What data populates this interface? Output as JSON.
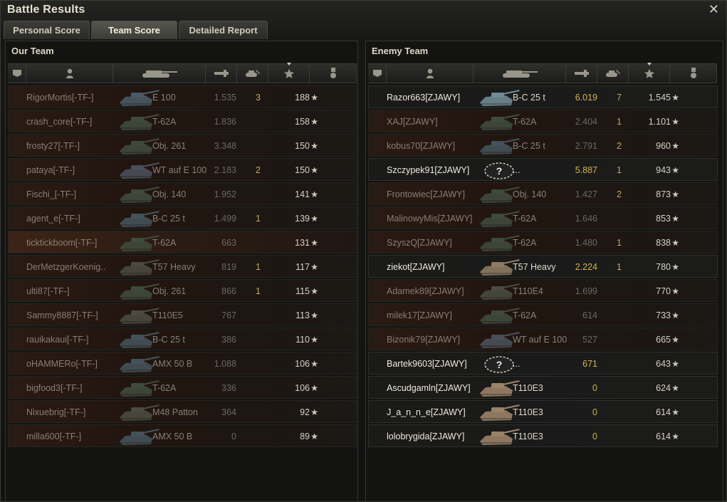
{
  "window": {
    "title": "Battle Results",
    "close": "✕"
  },
  "tabs": [
    "Personal Score",
    "Team Score",
    "Detailed Report"
  ],
  "active_tab": 1,
  "left": {
    "title": "Our Team",
    "rows": [
      {
        "name": "RigorMortis[-TF-]",
        "vehicle": "E 100",
        "damage": "1.535",
        "kills": "3",
        "xp": "188",
        "alive": false,
        "tank": "#4a5a66"
      },
      {
        "name": "crash_core[-TF-]",
        "vehicle": "T-62A",
        "damage": "1.836",
        "kills": "",
        "xp": "158",
        "alive": false,
        "tank": "#3f4a3c"
      },
      {
        "name": "frosty27[-TF-]",
        "vehicle": "Obj. 261",
        "damage": "3.348",
        "kills": "",
        "xp": "150",
        "alive": false,
        "tank": "#3f4a3c"
      },
      {
        "name": "pataya[-TF-]",
        "vehicle": "WT auf E 100",
        "damage": "2.183",
        "kills": "2",
        "xp": "150",
        "alive": false,
        "tank": "#4a4f5a"
      },
      {
        "name": "Fischi_[-TF-]",
        "vehicle": "Obj. 140",
        "damage": "1.952",
        "kills": "",
        "xp": "141",
        "alive": false,
        "tank": "#3f4a3c"
      },
      {
        "name": "agent_e[-TF-]",
        "vehicle": "B-C 25 t",
        "damage": "1.499",
        "kills": "1",
        "xp": "139",
        "alive": false,
        "tank": "#44525a"
      },
      {
        "name": "ticktickboom[-TF-]",
        "vehicle": "T-62A",
        "damage": "663",
        "kills": "",
        "xp": "131",
        "alive": false,
        "self": true,
        "tank": "#3f4a3c"
      },
      {
        "name": "DerMetzgerKoenig..",
        "vehicle": "T57 Heavy",
        "damage": "819",
        "kills": "1",
        "xp": "117",
        "alive": false,
        "tank": "#4a4a40"
      },
      {
        "name": "ulti87[-TF-]",
        "vehicle": "Obj. 261",
        "damage": "866",
        "kills": "1",
        "xp": "115",
        "alive": false,
        "tank": "#3f4a3c"
      },
      {
        "name": "Sammy8887[-TF-]",
        "vehicle": "T110E5",
        "damage": "767",
        "kills": "",
        "xp": "113",
        "alive": false,
        "tank": "#4a4a40"
      },
      {
        "name": "rauikakaui[-TF-]",
        "vehicle": "B-C 25 t",
        "damage": "386",
        "kills": "",
        "xp": "110",
        "alive": false,
        "tank": "#44525a"
      },
      {
        "name": "oHAMMERo[-TF-]",
        "vehicle": "AMX 50 B",
        "damage": "1.088",
        "kills": "",
        "xp": "106",
        "alive": false,
        "tank": "#44525a"
      },
      {
        "name": "bigfood3[-TF-]",
        "vehicle": "T-62A",
        "damage": "336",
        "kills": "",
        "xp": "106",
        "alive": false,
        "tank": "#3f4a3c"
      },
      {
        "name": "Nixuebrig[-TF-]",
        "vehicle": "M48 Patton",
        "damage": "364",
        "kills": "",
        "xp": "92",
        "alive": false,
        "tank": "#4a4a40"
      },
      {
        "name": "milla600[-TF-]",
        "vehicle": "AMX 50 B",
        "damage": "0",
        "kills": "",
        "xp": "89",
        "alive": false,
        "tank": "#44525a"
      }
    ]
  },
  "right": {
    "title": "Enemy Team",
    "rows": [
      {
        "name": "Razor663[ZJAWY]",
        "vehicle": "B-C 25 t",
        "damage": "6.019",
        "kills": "7",
        "xp": "1.545",
        "alive": true,
        "tank": "#6f8a92"
      },
      {
        "name": "XAJ[ZJAWY]",
        "vehicle": "T-62A",
        "damage": "2.404",
        "kills": "1",
        "xp": "1.101",
        "alive": false,
        "tank": "#3f4a3c"
      },
      {
        "name": "kobus70[ZJAWY]",
        "vehicle": "B-C 25 t",
        "damage": "2.791",
        "kills": "2",
        "xp": "960",
        "alive": false,
        "tank": "#44525a"
      },
      {
        "name": "Szczypek91[ZJAWY]",
        "vehicle": "...",
        "damage": "5.887",
        "kills": "1",
        "xp": "943",
        "alive": true,
        "unknown": true,
        "tank": "#555"
      },
      {
        "name": "Frontowiec[ZJAWY]",
        "vehicle": "Obj. 140",
        "damage": "1.427",
        "kills": "2",
        "xp": "873",
        "alive": false,
        "tank": "#3f4a3c"
      },
      {
        "name": "MalinowyMis[ZJAWY]",
        "vehicle": "T-62A",
        "damage": "1.646",
        "kills": "",
        "xp": "853",
        "alive": false,
        "tank": "#3f4a3c"
      },
      {
        "name": "SzyszQ[ZJAWY]",
        "vehicle": "T-62A",
        "damage": "1.480",
        "kills": "1",
        "xp": "838",
        "alive": false,
        "tank": "#3f4a3c"
      },
      {
        "name": "ziekot[ZJAWY]",
        "vehicle": "T57 Heavy",
        "damage": "2.224",
        "kills": "1",
        "xp": "780",
        "alive": true,
        "tank": "#8e7a60"
      },
      {
        "name": "Adamek89[ZJAWY]",
        "vehicle": "T110E4",
        "damage": "1.699",
        "kills": "",
        "xp": "770",
        "alive": false,
        "tank": "#4a4a40"
      },
      {
        "name": "milek17[ZJAWY]",
        "vehicle": "T-62A",
        "damage": "614",
        "kills": "",
        "xp": "733",
        "alive": false,
        "tank": "#3f4a3c"
      },
      {
        "name": "Bizonik79[ZJAWY]",
        "vehicle": "WT auf E 100",
        "damage": "527",
        "kills": "",
        "xp": "665",
        "alive": false,
        "tank": "#4a4f5a"
      },
      {
        "name": "Bartek9603[ZJAWY]",
        "vehicle": "...",
        "damage": "671",
        "kills": "",
        "xp": "643",
        "alive": true,
        "unknown": true,
        "tank": "#555"
      },
      {
        "name": "Ascudgamln[ZJAWY]",
        "vehicle": "T110E3",
        "damage": "0",
        "kills": "",
        "xp": "624",
        "alive": true,
        "tank": "#9a8268"
      },
      {
        "name": "J_a_n_n_e[ZJAWY]",
        "vehicle": "T110E3",
        "damage": "0",
        "kills": "",
        "xp": "614",
        "alive": true,
        "tank": "#9a8268"
      },
      {
        "name": "lolobrygida[ZJAWY]",
        "vehicle": "T110E3",
        "damage": "0",
        "kills": "",
        "xp": "614",
        "alive": true,
        "tank": "#9a8268"
      }
    ]
  },
  "columns": [
    "squad-icon",
    "player-icon",
    "vehicle-icon",
    "damage-icon",
    "kills-icon",
    "xp-star-icon",
    "medal-icon"
  ],
  "star_glyph": "★",
  "unknown_glyph": "?"
}
